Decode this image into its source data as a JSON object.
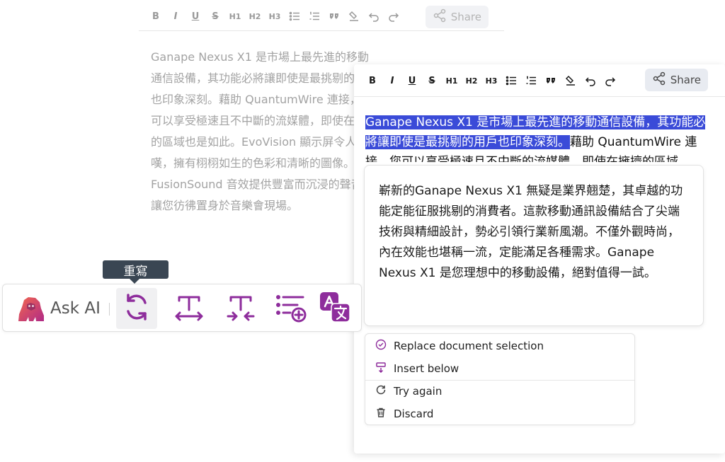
{
  "toolbar": {
    "buttons": [
      "B",
      "I",
      "U",
      "S",
      "H1",
      "H2",
      "H3",
      "bulleted-list",
      "numbered-list",
      "quote",
      "highlight",
      "undo",
      "redo"
    ],
    "share_label": "Share"
  },
  "background_editor": {
    "text": "Ganape Nexus X1 是市場上最先進的移動通信設備，其功能必將讓即使是最挑剔的用戶也印象深刻。藉助 QuantumWire 連接，您可以享受極速且不中斷的流媒體，即使在擁擠的區域也是如此。EvoVision 顯示屏令人驚嘆，擁有栩栩如生的色彩和清晰的圖像。FusionSound 音效提供豐富而沉浸的聲音，讓您彷彿置身於音樂會現場。"
  },
  "front_editor": {
    "selected_text": "Ganape Nexus X1 是市場上最先進的移動通信設備，其功能必將讓即使是最挑剔的用戶也印象深刻。",
    "rest_text": "藉助 QuantumWire 連接，您可以享受極速且不中斷的流媒體，即使在擁擠的區域"
  },
  "ai_result": {
    "text": "嶄新的Ganape Nexus X1 無疑是業界翹楚，其卓越的功能定能征服挑剔的消費者。這款移動通訊設備結合了尖端技術與精細設計，勢必引領行業新風潮。不僅外觀時尚，內在效能也堪稱一流，定能滿足各種需求。Ganape Nexus X1 是您理想中的移動設備，絕對值得一試。"
  },
  "ai_menu": {
    "items": [
      {
        "label": "Replace document selection",
        "icon": "check-circle-icon"
      },
      {
        "label": "Insert below",
        "icon": "insert-below-icon"
      },
      {
        "label": "Try again",
        "icon": "refresh-icon"
      },
      {
        "label": "Discard",
        "icon": "trash-icon"
      }
    ]
  },
  "ask_ai": {
    "label": "Ask AI",
    "tooltip": "重寫",
    "buttons": [
      "rewrite-icon",
      "expand-text-icon",
      "shorten-text-icon",
      "continue-writing-icon",
      "translate-icon"
    ],
    "accent_color": "#8e2d9c"
  }
}
